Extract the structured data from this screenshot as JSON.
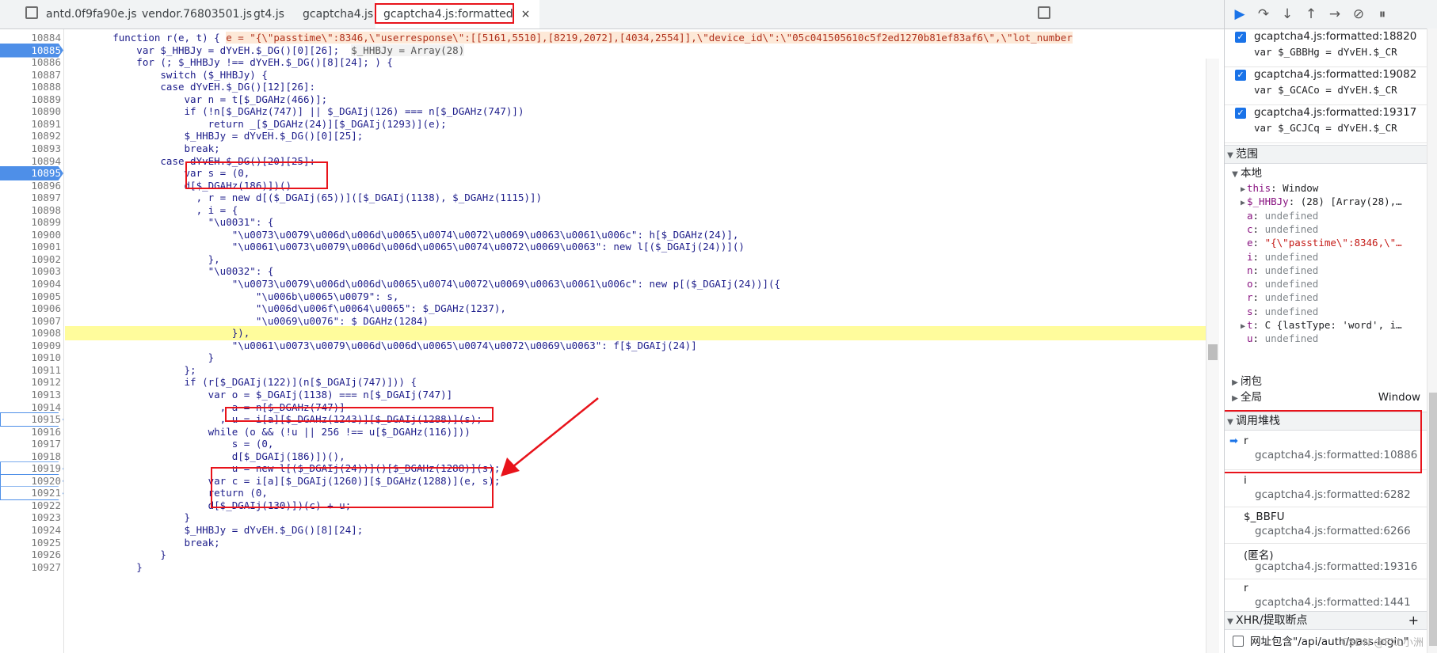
{
  "tabs": [
    {
      "label": "antd.0f9fa90e.js"
    },
    {
      "label": "vendor.76803501.js"
    },
    {
      "label": "gt4.js"
    },
    {
      "label": "gcaptcha4.js"
    },
    {
      "label": "gcaptcha4.js:formatted",
      "close": "×"
    }
  ],
  "editor": {
    "line_numbers": [
      "10884",
      "10885",
      "10886",
      "10887",
      "10888",
      "10889",
      "10890",
      "10891",
      "10892",
      "10893",
      "10894",
      "10895",
      "10896",
      "10897",
      "10898",
      "10899",
      "10900",
      "10901",
      "10902",
      "10903",
      "10904",
      "10905",
      "10906",
      "10907",
      "10908",
      "10909",
      "10910",
      "10911",
      "10912",
      "10913",
      "10914",
      "10915",
      "10916",
      "10917",
      "10918",
      "10919",
      "10920",
      "10921",
      "10922",
      "10923",
      "10924",
      "10925",
      "10926",
      "10927"
    ],
    "breakpoints": [
      "10885",
      "10895"
    ],
    "breakpoints_outline": [
      "10915",
      "10919",
      "10920",
      "10921"
    ],
    "current_line": "10908",
    "lines": [
      "        function r(e, t) {",
      "            var $_HHBJy = ",
      "            for (; $_HHBJy !== dYvEH.$_DG()[8][24]; ) {",
      "                switch ($_HHBJy) {",
      "                case dYvEH.$_DG()[12][26]:",
      "                    var n = t[$_DGAHz(466)];",
      "                    if (!n[$_DGAHz(747)] || $_DGAIj(126) === n[$_DGAHz(747)])",
      "                        return _[$_DGAHz(24)][$_DGAIj(1293)](e);",
      "                    $_HHBJy = dYvEH.$_DG()[0][25];",
      "                    break;",
      "                case dYvEH.$_DG()[20][25]:",
      "                    var s = (0,",
      "                    d[$_DGAHz(186)])()",
      "                      , r = new d[($_DGAIj(65))]([$_DGAIj(1138), $_DGAHz(1115)])",
      "                      , i = {",
      "                        \"\\u0031\": {",
      "                            \"\\u0073\\u0079\\u006d\\u006d\\u0065\\u0074\\u0072\\u0069\\u0063\\u0061\\u006c\": h[$_DGAHz(24)],",
      "                            \"\\u0061\\u0073\\u0079\\u006d\\u006d\\u0065\\u0074\\u0072\\u0069\\u0063\": new l[($_DGAIj(24))]()",
      "                        },",
      "                        \"\\u0032\": {",
      "                            \"\\u0073\\u0079\\u006d\\u006d\\u0065\\u0074\\u0072\\u0069\\u0063\\u0061\\u006c\": new p[($_DGAIj(24))]({",
      "                                \"\\u006b\\u0065\\u0079\": s,",
      "                                \"\\u006d\\u006f\\u0064\\u0065\": $_DGAHz(1237),",
      "                                \"\\u0069\\u0076\": $_DGAHz(1284)",
      "                            }),",
      "                            \"\\u0061\\u0073\\u0079\\u006d\\u006d\\u0065\\u0074\\u0072\\u0069\\u0063\": f[$_DGAIj(24)]",
      "                        }",
      "                    };",
      "                    if (r[$_DGAIj(122)](n[$_DGAIj(747)])) {",
      "                        var o = $_DGAIj(1138) === n[$_DGAIj(747)]",
      "                          , a = n[$_DGAHz(747)]",
      "                          , u = i[a][$_DGAHz(1243)][$_DGAIj(1288)](s);",
      "                        while (o && (!u || 256 !== u[$_DGAHz(116)]))",
      "                            s = (0,",
      "                            d[$_DGAIj(186)])(),",
      "                            u = new l[($_DGAIj(24))]()[$_DGAHz(1288)](s);",
      "                        var c = i[a][$_DGAIj(1260)][$_DGAHz(1288)](e, s);",
      "                        return (0,",
      "                        d[$_DGAIj(130)])(c) + u;",
      "                    }",
      "                    $_HHBJy = dYvEH.$_DG()[8][24];",
      "                    break;",
      "                }",
      "            }"
    ],
    "line_10885_rest": "dYvEH.$_DG()[0][26];",
    "inline_value_e": "e = \"{\\\"passtime\\\":8346,\\\"userresponse\\\":[[5161,5510],[8219,2072],[4034,2554]],\\\"device_id\\\":\\\"05c041505610c5f2ed1270b81ef83af6\\\",\\\"lot_number",
    "inline_value_hhbjy": "$_HHBJy = Array(28)"
  },
  "debugger_toolbar": {
    "icons": [
      "resume-icon",
      "step-over-icon",
      "step-into-icon",
      "step-out-icon",
      "step-icon",
      "deactivate-breakpoints-icon",
      "pause-on-exceptions-icon"
    ]
  },
  "breakpoints_list": [
    {
      "file": "gcaptcha4.js:formatted:18820",
      "code": "var $_GBBHg = dYvEH.$_CR"
    },
    {
      "file": "gcaptcha4.js:formatted:19082",
      "code": "var $_GCACo = dYvEH.$_CR"
    },
    {
      "file": "gcaptcha4.js:formatted:19317",
      "code": "var $_GCJCq = dYvEH.$_CR"
    }
  ],
  "scope": {
    "header": "范围",
    "local_label": "本地",
    "rows": [
      {
        "name": "this",
        "value": "Window",
        "expandable": true
      },
      {
        "name": "$_HHBJy",
        "value": "(28) [Array(28),…",
        "expandable": true
      },
      {
        "name": "a",
        "value": "undefined"
      },
      {
        "name": "c",
        "value": "undefined"
      },
      {
        "name": "e",
        "value": "\"{\\\"passtime\\\":8346,\\\"…"
      },
      {
        "name": "i",
        "value": "undefined"
      },
      {
        "name": "n",
        "value": "undefined"
      },
      {
        "name": "o",
        "value": "undefined"
      },
      {
        "name": "r",
        "value": "undefined"
      },
      {
        "name": "s",
        "value": "undefined"
      },
      {
        "name": "t",
        "value": "C {lastType: 'word', i…",
        "expandable": true
      },
      {
        "name": "u",
        "value": "undefined"
      }
    ],
    "closure_label": "闭包",
    "global_label": "全局",
    "global_value": "Window"
  },
  "call_stack": {
    "header": "调用堆栈",
    "frames": [
      {
        "name": "r",
        "location": "gcaptcha4.js:formatted:10886"
      },
      {
        "name": "i",
        "location": "gcaptcha4.js:formatted:6282"
      },
      {
        "name": "$_BBFU",
        "location": "gcaptcha4.js:formatted:6266"
      },
      {
        "name": "(匿名)",
        "location": "gcaptcha4.js:formatted:19316"
      },
      {
        "name": "r",
        "location": "gcaptcha4.js:formatted:1441"
      }
    ]
  },
  "xhr": {
    "header": "XHR/提取断点",
    "add": "+",
    "item": "网址包含\"/api/auth/pass-login\""
  },
  "watermark": "CSDN @FXL小洲",
  "colors": {
    "accent": "#1a73e8",
    "annotation": "#e8131b",
    "current_line": "#fffc9c"
  }
}
